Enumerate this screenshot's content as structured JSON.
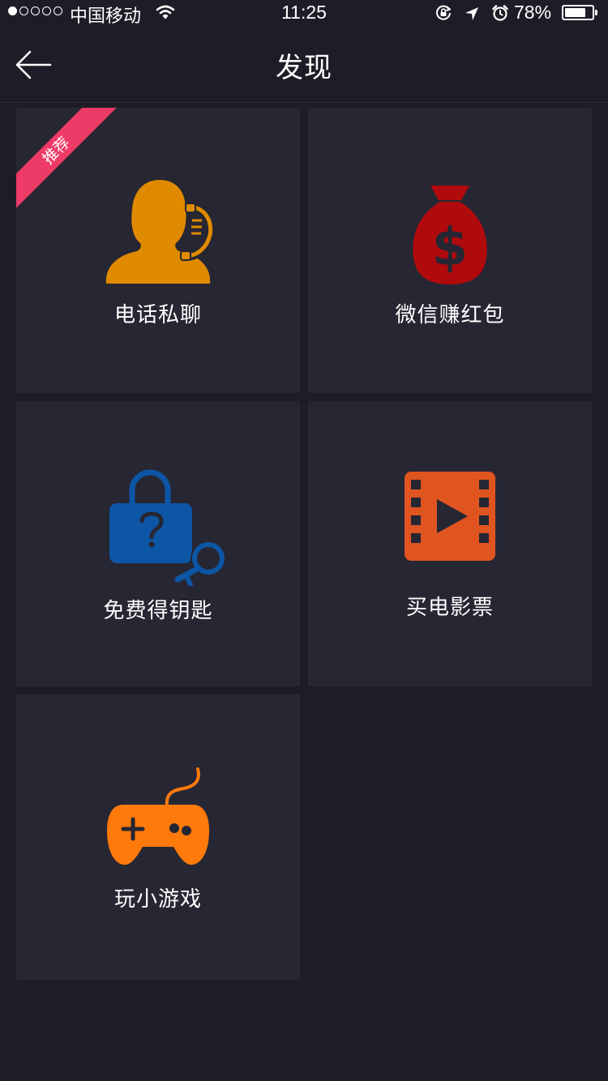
{
  "status_bar": {
    "carrier": "中国移动",
    "time": "11:25",
    "battery_percent": "78%",
    "battery_level": 0.78,
    "signal_bars_filled": 1,
    "signal_bars_total": 5
  },
  "nav": {
    "title": "发现",
    "back_icon": "arrow-left-icon"
  },
  "tiles": [
    {
      "label": "电话私聊",
      "icon": "phone-contact-icon",
      "color": "#e08a00",
      "badge": "推荐"
    },
    {
      "label": "微信赚红包",
      "icon": "money-bag-icon",
      "color": "#b10a0c"
    },
    {
      "label": "免费得钥匙",
      "icon": "lock-key-icon",
      "color": "#0d56a6"
    },
    {
      "label": "买电影票",
      "icon": "film-icon",
      "color": "#e0541f"
    },
    {
      "label": "玩小游戏",
      "icon": "gamepad-icon",
      "color": "#ff7a0a"
    }
  ],
  "colors": {
    "background": "#1e1d27",
    "tile": "#272633",
    "badge": "#ee3a67"
  }
}
